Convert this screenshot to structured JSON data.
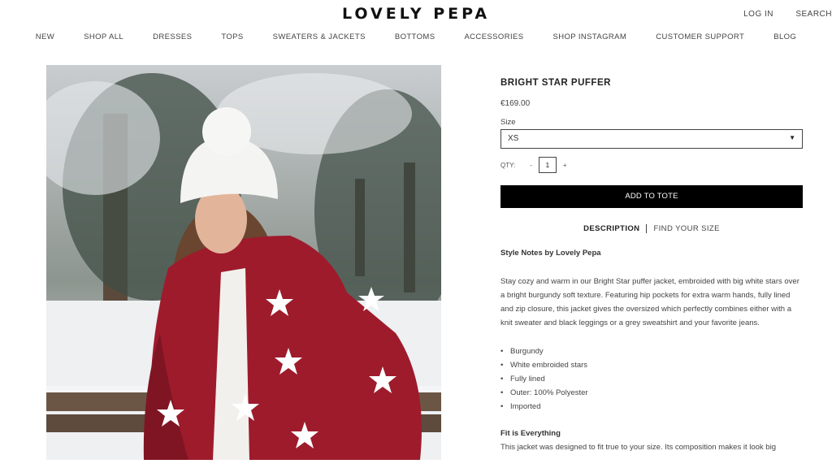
{
  "header": {
    "logo": "LOVELY PEPA",
    "login": "LOG IN",
    "search": "SEARCH"
  },
  "nav": [
    "NEW",
    "SHOP ALL",
    "DRESSES",
    "TOPS",
    "SWEATERS & JACKETS",
    "BOTTOMS",
    "ACCESSORIES",
    "SHOP INSTAGRAM",
    "CUSTOMER SUPPORT",
    "BLOG"
  ],
  "product": {
    "title": "BRIGHT STAR PUFFER",
    "price": "€169.00",
    "size_label": "Size",
    "size_value": "XS",
    "qty_label": "QTY:",
    "qty_minus": "-",
    "qty_value": "1",
    "qty_plus": "+",
    "add_button": "ADD TO TOTE",
    "tab_description": "DESCRIPTION",
    "tab_size": "FIND YOUR SIZE",
    "style_heading": "Style Notes by Lovely Pepa",
    "style_body": "Stay cozy and warm in our Bright Star puffer jacket, embroided with big white stars over a bright burgundy soft texture. Featuring hip pockets for extra warm hands, fully lined and zip closure, this jacket gives the oversized which perfectly combines either with a knit sweater and black leggings or a grey sweatshirt and your favorite jeans.",
    "features": [
      "Burgundy",
      "White embroided stars",
      "Fully lined",
      "Outer: 100% Polyester",
      "Imported"
    ],
    "fit_heading": "Fit is Everything",
    "fit_body": "This jacket was designed to fit true to your size. Its composition makes it look big"
  },
  "colors": {
    "jacket": "#9e1b2c",
    "button": "#000000",
    "snow": "#eef0f2"
  }
}
